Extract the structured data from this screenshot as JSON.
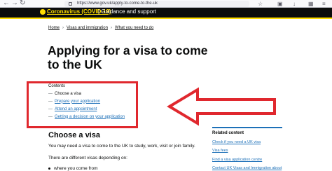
{
  "browser": {
    "url": "https://www.gov.uk/apply-to-come-to-the-uk"
  },
  "header": {
    "covid_link": "Coronavirus (COVID-19)",
    "guidance_text": "| Guidance and support"
  },
  "breadcrumbs": [
    "Home",
    "Visas and immigration",
    "What you need to do"
  ],
  "page_title": "Applying for a visa to come to the UK",
  "contents": {
    "heading": "Contents",
    "items": [
      {
        "label": "Choose a visa",
        "current": true
      },
      {
        "label": "Prepare your application",
        "current": false
      },
      {
        "label": "Attend an appointment",
        "current": false
      },
      {
        "label": "Getting a decision on your application",
        "current": false
      }
    ]
  },
  "section": {
    "heading": "Choose a visa",
    "paragraph1": "You may need a visa to come to the UK to study, work, visit or join family.",
    "paragraph2": "There are different visas depending on:",
    "bullet1": "where you come from"
  },
  "related": {
    "heading": "Related content",
    "links": [
      "Check if you need a UK visa",
      "Visa fees",
      "Find a visa application centre",
      "Contact UK Visas and Immigration about"
    ]
  },
  "colors": {
    "annotation_red": "#e0282e",
    "govuk_link_blue": "#1d70b8",
    "govuk_yellow": "#ffdd00",
    "header_black": "#0b0c0c"
  }
}
